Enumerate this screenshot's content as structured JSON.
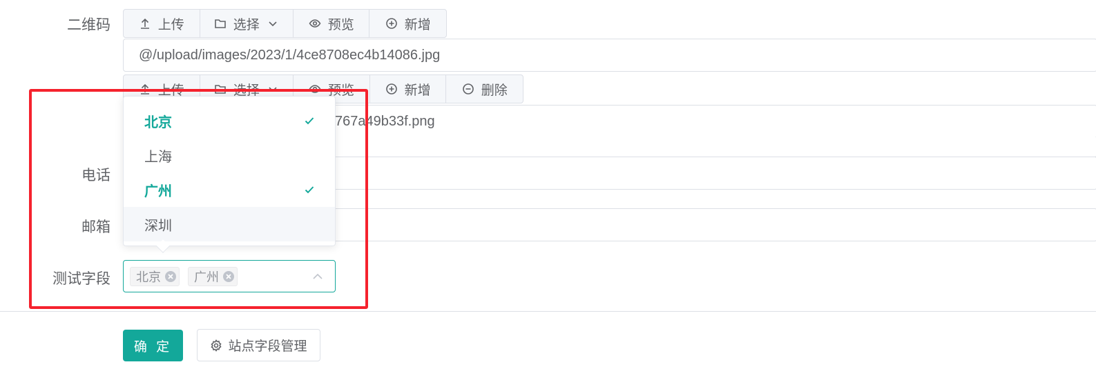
{
  "form": {
    "qrcode_label": "二维码",
    "phone_label": "电话",
    "email_label": "邮箱",
    "test_field_label": "测试字段"
  },
  "toolbar1": {
    "upload": "上传",
    "select": "选择",
    "preview": "预览",
    "add": "新增"
  },
  "toolbar2": {
    "upload": "上传",
    "select": "选择",
    "preview": "预览",
    "add": "新增",
    "delete": "删除"
  },
  "fields": {
    "qrcode_path1": "@/upload/images/2023/1/4ce8708ec4b14086.jpg",
    "qrcode_path2_visible": "767a49b33f.png"
  },
  "select": {
    "tags": [
      "北京",
      "广州"
    ],
    "options": [
      {
        "label": "北京",
        "selected": true
      },
      {
        "label": "上海",
        "selected": false
      },
      {
        "label": "广州",
        "selected": true
      },
      {
        "label": "深圳",
        "selected": false,
        "hovered": true
      }
    ]
  },
  "actions": {
    "confirm": "确 定",
    "manage_fields": "站点字段管理"
  },
  "colors": {
    "primary": "#13a89a",
    "highlight": "#f5222d",
    "border": "#dcdfe6"
  },
  "icons": [
    "upload-icon",
    "folder-icon",
    "chevron-down-icon",
    "eye-icon",
    "plus-circle-icon",
    "minus-circle-icon",
    "check-icon",
    "close-circle-icon",
    "chevron-up-icon",
    "gear-icon"
  ]
}
